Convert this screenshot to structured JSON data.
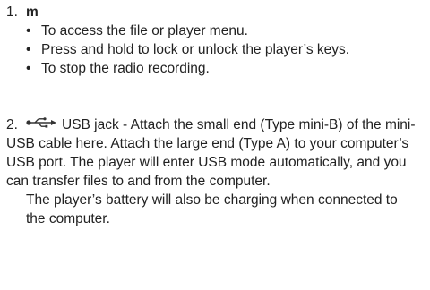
{
  "item1": {
    "number": "1.",
    "key": "m",
    "bullets": [
      "To access the file or player menu.",
      "Press and hold to lock or unlock the player’s keys.",
      "To stop the radio recording."
    ]
  },
  "item2": {
    "number": "2.",
    "icon": "usb-icon",
    "paragraph": "USB jack - Attach the small end (Type mini-B) of the mini-USB cable here. Attach the large end (Type A) to your computer’s USB port. The player will enter USB mode automatically, and you can transfer files to and from the computer.",
    "note": "The player’s battery will also be charging when connected to the computer."
  }
}
